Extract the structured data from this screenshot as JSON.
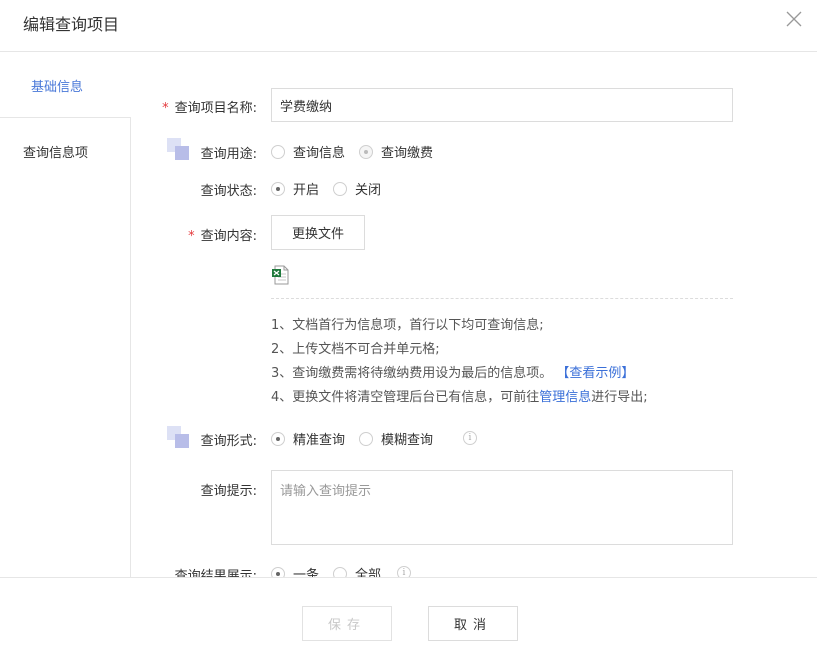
{
  "dialog": {
    "title": "编辑查询项目"
  },
  "sidebar": {
    "items": [
      {
        "label": "基础信息"
      },
      {
        "label": "查询信息项"
      }
    ]
  },
  "form": {
    "name": {
      "label": "查询项目名称:",
      "required": true,
      "value": "学费缴纳"
    },
    "purpose": {
      "label": "查询用途:",
      "options": [
        "查询信息",
        "查询缴费"
      ],
      "selected": "查询缴费"
    },
    "status": {
      "label": "查询状态:",
      "options": [
        "开启",
        "关闭"
      ],
      "selected": "开启"
    },
    "content": {
      "label": "查询内容:",
      "required": true,
      "button": "更换文件",
      "file_icon": "excel-file-icon",
      "notes": [
        "1、文档首行为信息项，首行以下均可查询信息;",
        "2、上传文档不可合并单元格;",
        "3、查询缴费需将待缴纳费用设为最后的信息项。",
        "4、更换文件将清空管理后台已有信息，可前往"
      ],
      "note3_link": "【查看示例】",
      "note4_link": "管理信息",
      "note4_suffix": "进行导出;"
    },
    "mode": {
      "label": "查询形式:",
      "options": [
        "精准查询",
        "模糊查询"
      ],
      "selected": "精准查询"
    },
    "hint": {
      "label": "查询提示:",
      "placeholder": "请输入查询提示"
    },
    "result": {
      "label": "查询结果展示:",
      "options": [
        "一条",
        "全部"
      ],
      "selected": "一条"
    }
  },
  "footer": {
    "save": "保存",
    "cancel": "取消"
  },
  "colors": {
    "accent": "#4a78d8",
    "link": "#3a6fd8",
    "required": "#e4393c",
    "border": "#e6e6e6"
  }
}
